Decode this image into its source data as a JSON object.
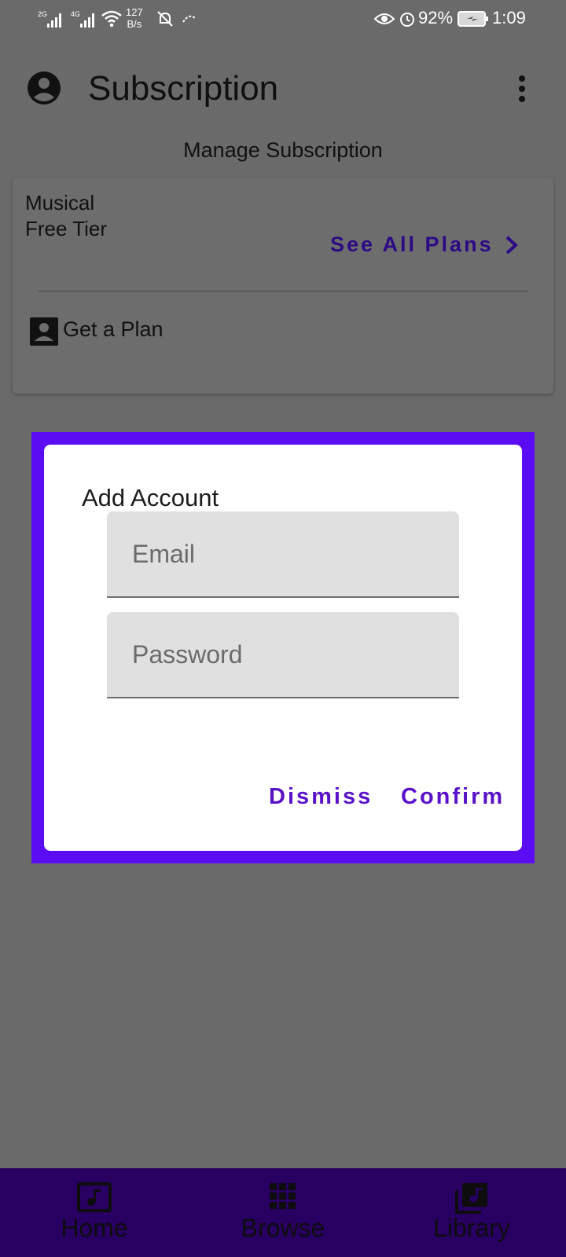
{
  "status_bar": {
    "network1": "2G",
    "network2": "4G",
    "data_rate_value": "127",
    "data_rate_unit": "B/s",
    "battery": "92%",
    "time": "1:09"
  },
  "app_bar": {
    "title": "Subscription"
  },
  "manage": {
    "title": "Manage Subscription"
  },
  "plan_card": {
    "plan_line1": "Musical",
    "plan_line2": "Free Tier",
    "see_all": "See All Plans",
    "get_plan": "Get a Plan"
  },
  "dialog": {
    "title": "Add Account",
    "email_placeholder": "Email",
    "password_placeholder": "Password",
    "dismiss": "Dismiss",
    "confirm": "Confirm"
  },
  "bottom_nav": {
    "items": [
      {
        "label": "Home",
        "icon": "music-note-icon"
      },
      {
        "label": "Browse",
        "icon": "grid-icon"
      },
      {
        "label": "Library",
        "icon": "library-music-icon"
      }
    ]
  },
  "colors": {
    "accent": "#5c0cf2",
    "nav_background": "#270061",
    "scrim_background": "#6a6a6a"
  }
}
